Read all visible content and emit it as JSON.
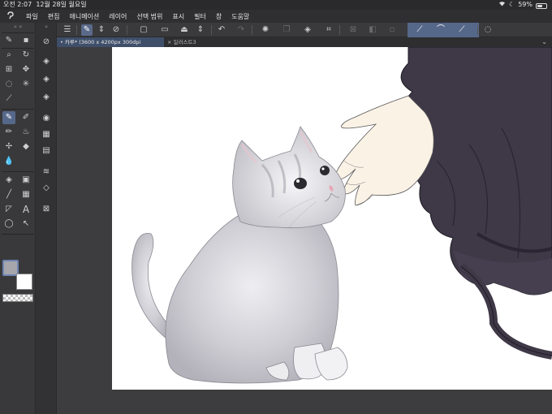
{
  "status_bar": {
    "time": "오전 2:07",
    "date": "12월 28일 월요일",
    "battery": "59%",
    "battery_level": 0.59
  },
  "menu": {
    "items": [
      "파일",
      "편집",
      "애니메이션",
      "레이어",
      "선택 범위",
      "표시",
      "필터",
      "창",
      "도움말"
    ]
  },
  "tabs": [
    {
      "label": "카루* (3600 x 4200px 300dpi 105.6%)",
      "active": true
    },
    {
      "label": "일러스트3",
      "active": false
    }
  ],
  "colors": {
    "accent": "#56688a",
    "main_color": "#a7a6ad",
    "sub_color": "#ffffff",
    "panel_bg": "#39393b",
    "canvas_bg": "#3d3d3f",
    "dress": "#3e3847",
    "skin": "#fbf2e6"
  },
  "tool_icons": [
    "zoom-icon",
    "rotate-icon",
    "move-layer-icon",
    "hand-icon",
    "lasso-select-icon",
    "magic-wand-icon",
    "eyedropper-icon",
    "pen-icon",
    "pencil-icon",
    "brush-icon",
    "airbrush-icon",
    "decoration-icon",
    "eraser-icon",
    "blend-icon",
    "fill-icon",
    "gradient-icon",
    "figure-icon",
    "frame-icon",
    "ruler-icon",
    "text-icon",
    "balloon-icon",
    "correct-line-icon"
  ]
}
